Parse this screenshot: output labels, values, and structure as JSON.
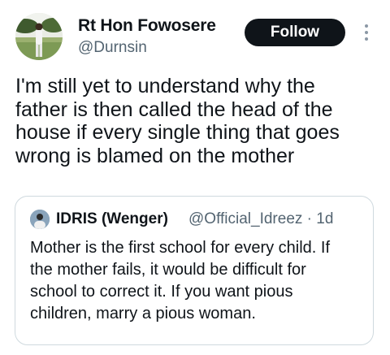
{
  "tweet": {
    "author": {
      "name": "Rt Hon Fowosere",
      "handle": "@Durnsin"
    },
    "follow_label": "Follow",
    "body_lines": [
      "I'm still yet to understand why the",
      "father is then called the head of the",
      "house if every single thing that goes",
      "wrong is blamed on the mother"
    ]
  },
  "quoted_tweet": {
    "author_name": "IDRIS (Wenger)",
    "meta": "@Official_Idreez · 1d",
    "body_lines": [
      "Mother is the first school for every child. If",
      "the mother fails, it would be difficult for",
      "school to correct it. If you want pious",
      "children, marry a pious woman."
    ]
  },
  "icons": {
    "more": "more-vertical-icon"
  },
  "colors": {
    "text_primary": "#0f1419",
    "text_secondary": "#536471",
    "follow_button_bg": "#0f1419",
    "follow_button_text": "#ffffff",
    "quote_border": "#cfd9de"
  }
}
